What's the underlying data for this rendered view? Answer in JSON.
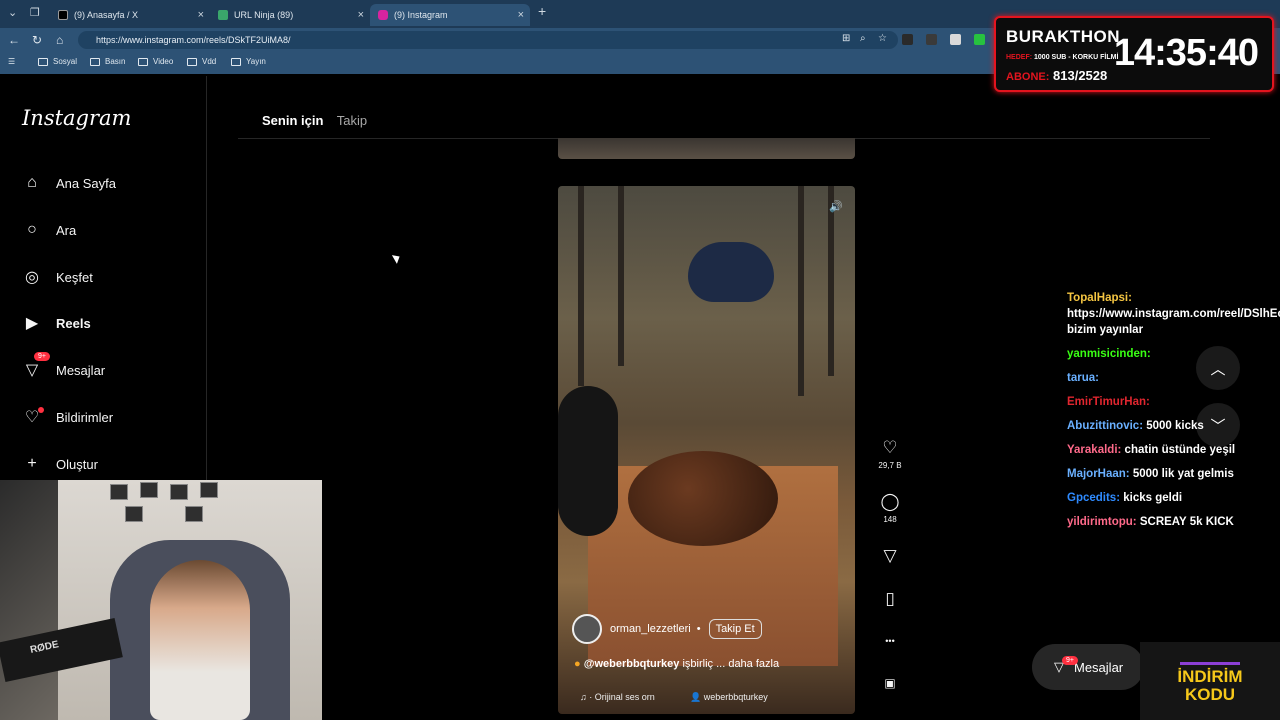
{
  "browser": {
    "tabs": [
      {
        "title": "(9) Anasayfa / X"
      },
      {
        "title": "URL Ninja (89)"
      },
      {
        "title": "(9) Instagram"
      }
    ],
    "new_tab": "+",
    "url": "https://www.instagram.com/reels/DSkTF2UiMA8/",
    "bookmarks": [
      "Sosyal",
      "Basın",
      "Video",
      "Vdd",
      "Yayın"
    ]
  },
  "instagram": {
    "logo": "Instagram",
    "nav": [
      {
        "label": "Ana Sayfa",
        "icon": "home-icon"
      },
      {
        "label": "Ara",
        "icon": "search-icon"
      },
      {
        "label": "Keşfet",
        "icon": "compass-icon"
      },
      {
        "label": "Reels",
        "icon": "reels-icon"
      },
      {
        "label": "Mesajlar",
        "icon": "messenger-icon",
        "badge": "9+"
      },
      {
        "label": "Bildirimler",
        "icon": "heart-icon"
      },
      {
        "label": "Oluştur",
        "icon": "plus-icon"
      }
    ],
    "feed_tabs": {
      "active": "Senin için",
      "inactive": "Takip"
    },
    "reel": {
      "username": "orman_lezzetleri",
      "follow": "Takip Et",
      "collab_user": "@weberbbqturkey",
      "collab_text": "işbirliç ... daha fazla",
      "audio": "· Orijinal ses  orn",
      "audio_user": "weberbbqturkey"
    },
    "actions": {
      "likes": "29,7 B",
      "comments": "148"
    },
    "messages_bar": {
      "label": "Mesajlar",
      "badge": "9+"
    }
  },
  "chat": [
    {
      "user": "TopalHapsi:",
      "text": "https://www.instagram.com/reel/DSlhEoXgGRb/ bizim yayınlar",
      "color": "#f4c542"
    },
    {
      "user": "yanmisicinden:",
      "text": "",
      "color": "#39ff14"
    },
    {
      "user": "tarua:",
      "text": "",
      "color": "#6ab0ff"
    },
    {
      "user": "EmirTimurHan:",
      "text": "",
      "color": "#e0262f"
    },
    {
      "user": "Abuzittinovic:",
      "text": "5000 kicks",
      "color": "#6ab0ff"
    },
    {
      "user": "Yarakaldi:",
      "text": "chatin üstünde yeşil",
      "color": "#ff6a8a"
    },
    {
      "user": "MajorHaan:",
      "text": "5000 lik yat gelmis",
      "color": "#6ab0ff"
    },
    {
      "user": "Gpcedits:",
      "text": "kicks geldi",
      "color": "#2f8bff"
    },
    {
      "user": "yildirimtopu:",
      "text": "SCREAY 5k KICK",
      "color": "#ff6a8a"
    }
  ],
  "subathon": {
    "title": "BURAKTHON",
    "hedef_label": "HEDEF:",
    "hedef_text": "1000 SUB - KORKU FİLMİ",
    "abone_label": "ABONE:",
    "abone_value": "813/2528",
    "timer": "14:35:40"
  },
  "webcam": {
    "mic_brand": "RØDE"
  },
  "promo": {
    "line1": "İNDİRİM",
    "line2": "KODU"
  }
}
